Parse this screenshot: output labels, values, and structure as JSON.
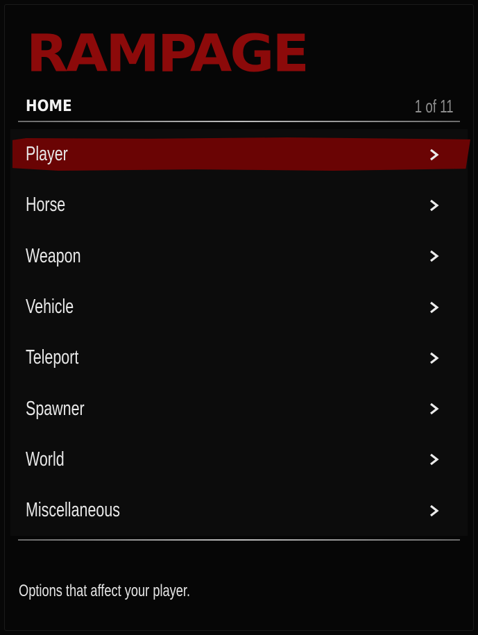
{
  "app": {
    "logo_text": "RAMPAGE",
    "accent_color": "#8c0a0a",
    "selection_color": "#6a0404"
  },
  "header": {
    "title": "HOME",
    "page_counter": "1 of 11"
  },
  "menu": {
    "selected_index": 0,
    "items": [
      {
        "label": "Player",
        "icon": "chevron-right-icon"
      },
      {
        "label": "Horse",
        "icon": "chevron-right-icon"
      },
      {
        "label": "Weapon",
        "icon": "chevron-right-icon"
      },
      {
        "label": "Vehicle",
        "icon": "chevron-right-icon"
      },
      {
        "label": "Teleport",
        "icon": "chevron-right-icon"
      },
      {
        "label": "Spawner",
        "icon": "chevron-right-icon"
      },
      {
        "label": "World",
        "icon": "chevron-right-icon"
      },
      {
        "label": "Miscellaneous",
        "icon": "chevron-right-icon"
      }
    ]
  },
  "footer": {
    "description": "Options that affect your player."
  }
}
